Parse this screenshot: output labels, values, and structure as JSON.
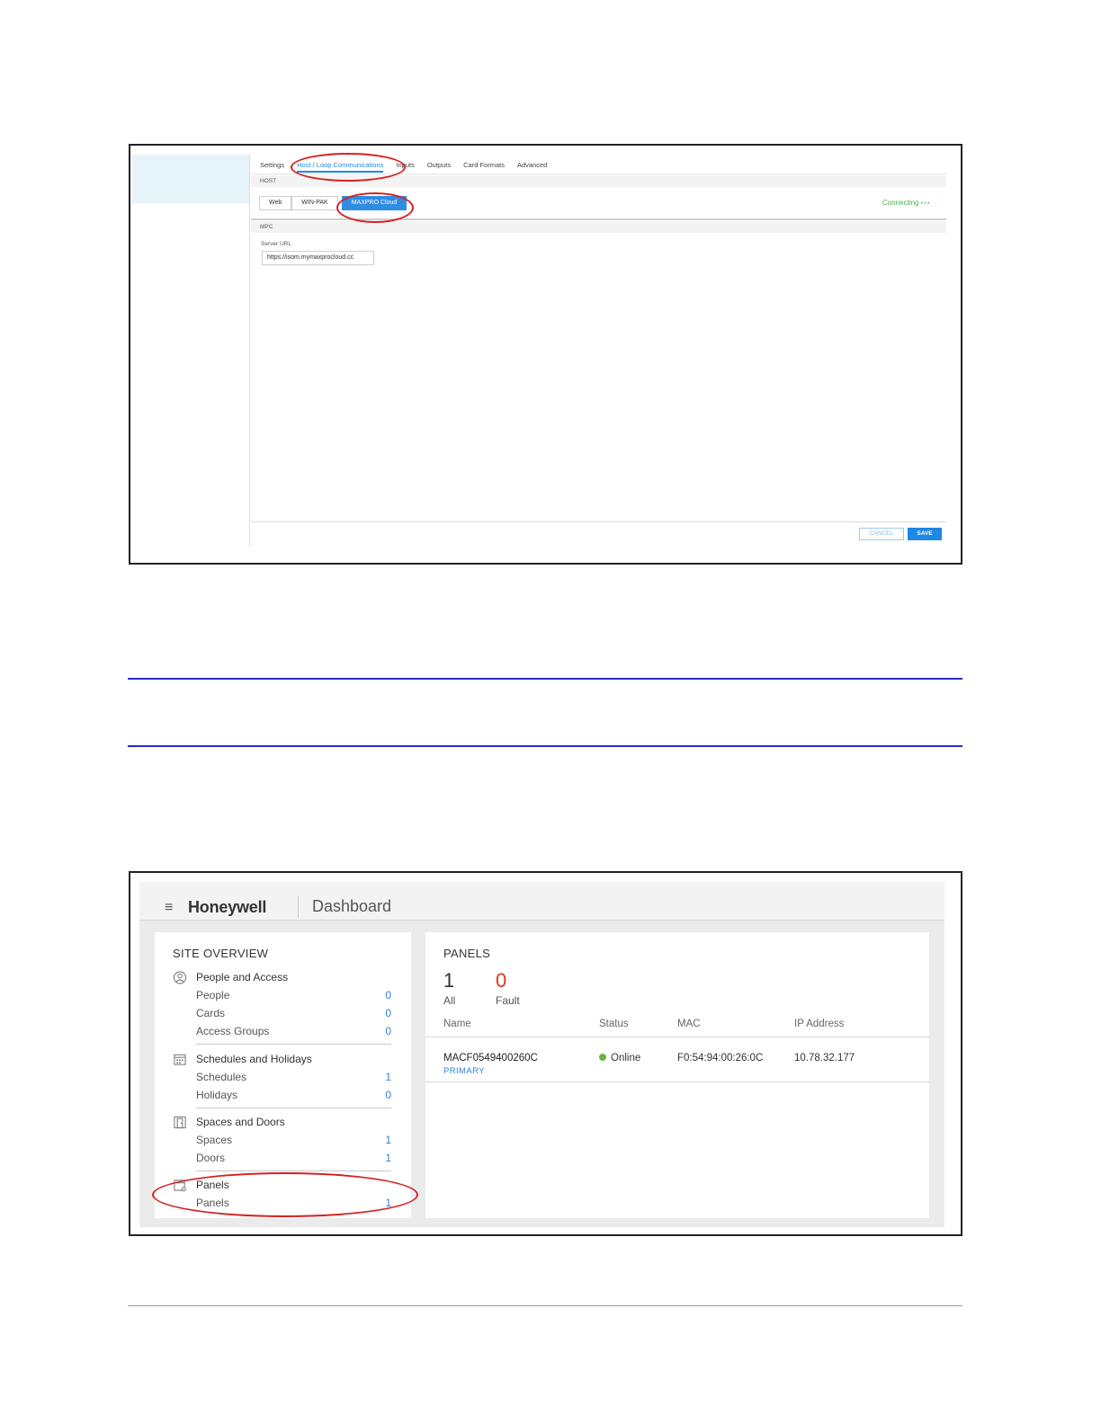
{
  "screen1": {
    "tabs": [
      "Settings",
      "Host / Loop Communications",
      "Inputs",
      "Outputs",
      "Card Formats",
      "Advanced"
    ],
    "section_host": "HOST",
    "host_options": [
      "Web",
      "WIN-PAK",
      "MAXPRO Cloud"
    ],
    "status": "Connecting",
    "status_dots": "• • •",
    "section_mpc": "MPC",
    "server_url_label": "Server URL",
    "server_url_value": "https://isom.mymaxprocloud.cc",
    "cancel_label": "CANCEL",
    "save_label": "SAVE",
    "colors": {
      "accent": "#1e88e5",
      "status_green": "#4caf50",
      "highlight_red": "#d62020"
    }
  },
  "screen2": {
    "menu_icon": "≡",
    "brand": "Honeywell",
    "page_title": "Dashboard",
    "site_overview": {
      "title": "SITE OVERVIEW",
      "groups": [
        {
          "title": "People and Access",
          "icon": "person-circle-icon",
          "items": [
            {
              "label": "People",
              "count": "0"
            },
            {
              "label": "Cards",
              "count": "0"
            },
            {
              "label": "Access Groups",
              "count": "0"
            }
          ]
        },
        {
          "title": "Schedules and Holidays",
          "icon": "calendar-icon",
          "items": [
            {
              "label": "Schedules",
              "count": "1"
            },
            {
              "label": "Holidays",
              "count": "0"
            }
          ]
        },
        {
          "title": "Spaces and Doors",
          "icon": "door-icon",
          "items": [
            {
              "label": "Spaces",
              "count": "1"
            },
            {
              "label": "Doors",
              "count": "1"
            }
          ]
        },
        {
          "title": "Panels",
          "icon": "panel-icon",
          "items": [
            {
              "label": "Panels",
              "count": "1"
            }
          ]
        }
      ]
    },
    "panels": {
      "title": "PANELS",
      "all_count": "1",
      "all_label": "All",
      "fault_count": "0",
      "fault_label": "Fault",
      "columns": [
        "Name",
        "Status",
        "MAC",
        "IP Address"
      ],
      "rows": [
        {
          "name": "MACF0549400260C",
          "tag": "PRIMARY",
          "status": "Online",
          "mac": "F0:54:94:00:26:0C",
          "ip": "10.78.32.177"
        }
      ]
    },
    "colors": {
      "link_blue": "#2f80d8",
      "fault_red": "#d9381e",
      "online_green": "#6fb53b"
    }
  }
}
